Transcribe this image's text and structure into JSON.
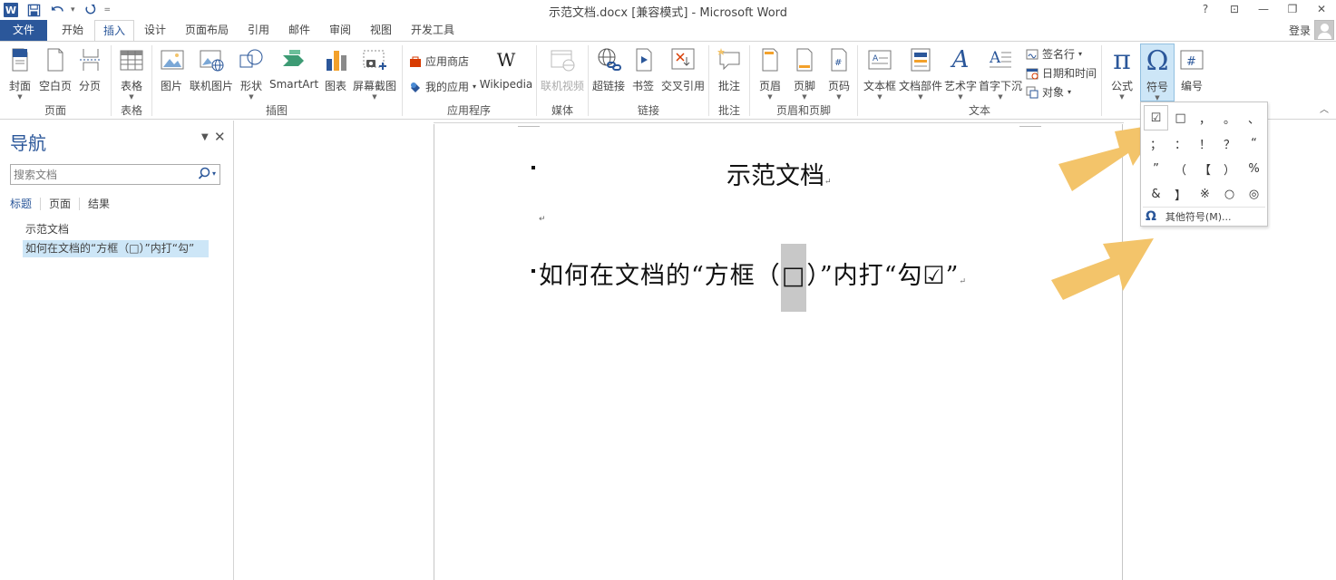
{
  "window": {
    "title": "示范文档.docx [兼容模式] - Microsoft Word",
    "app_logo": "W"
  },
  "qat": {
    "icons": [
      "save-icon",
      "undo-icon",
      "redo-icon"
    ],
    "more": "="
  },
  "window_controls": {
    "help": "?",
    "ribbon_display": "⊡",
    "minimize": "—",
    "restore": "❐",
    "close": "✕"
  },
  "tabs": [
    {
      "label": "文件"
    },
    {
      "label": "开始"
    },
    {
      "label": "插入"
    },
    {
      "label": "设计"
    },
    {
      "label": "页面布局"
    },
    {
      "label": "引用"
    },
    {
      "label": "邮件"
    },
    {
      "label": "审阅"
    },
    {
      "label": "视图"
    },
    {
      "label": "开发工具"
    }
  ],
  "account": {
    "login_label": "登录"
  },
  "ribbon": {
    "groups": {
      "pages": "页面",
      "tables": "表格",
      "illustrations": "插图",
      "apps": "应用程序",
      "media": "媒体",
      "links": "链接",
      "comments": "批注",
      "header_footer": "页眉和页脚",
      "text": "文本"
    },
    "buttons": {
      "cover": "封面",
      "blank_page": "空白页",
      "page_break": "分页",
      "table": "表格",
      "picture": "图片",
      "online_picture": "联机图片",
      "shapes": "形状",
      "smartart": "SmartArt",
      "chart": "图表",
      "screenshot": "屏幕截图",
      "app_store": "应用商店",
      "my_apps": "我的应用",
      "wikipedia": "Wikipedia",
      "wiki_glyph": "W",
      "online_video": "联机视频",
      "hyperlink": "超链接",
      "bookmark": "书签",
      "cross_ref": "交叉引用",
      "comment": "批注",
      "header": "页眉",
      "footer": "页脚",
      "page_number": "页码",
      "textbox": "文本框",
      "quick_parts": "文档部件",
      "wordart": "艺术字",
      "dropcap": "首字下沉",
      "signature_line": "签名行",
      "date_time": "日期和时间",
      "object": "对象",
      "equation": "公式",
      "symbol": "符号",
      "numbering": "编号",
      "pi_glyph": "π",
      "omega_glyph": "Ω",
      "hash_glyph": "#"
    }
  },
  "nav": {
    "title": "导航",
    "search_placeholder": "搜索文档",
    "tabs": [
      "标题",
      "页面",
      "结果"
    ],
    "headings": [
      "示范文档",
      "如何在文档的“方框（□）”内打“勾”"
    ]
  },
  "document": {
    "title": "示范文档",
    "line2_before": "如何在文档的“方框（",
    "line2_box": "□",
    "line2_after": "）”内打“勾☑”",
    "para_mark": "↵"
  },
  "symbol_dropdown": {
    "symbols": [
      "☑",
      "□",
      "，",
      "。",
      "、",
      "；",
      "：",
      "！",
      "？",
      "“",
      "”",
      "（",
      "【",
      "）",
      "%",
      "&",
      "】",
      "※",
      "○",
      "◎"
    ],
    "more_label": "其他符号(M)...",
    "more_icon": "Ω"
  },
  "colors": {
    "accent": "#2b579a",
    "arrow": "#f3c46a",
    "selection": "#cde6f7"
  }
}
